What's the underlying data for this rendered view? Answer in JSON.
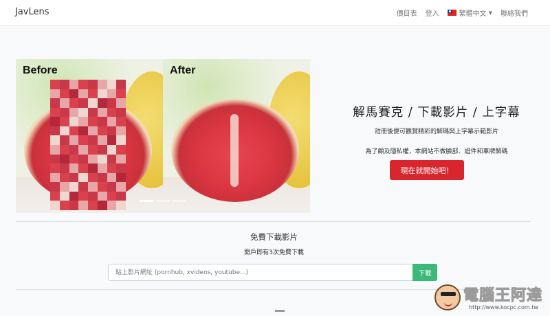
{
  "navbar": {
    "brand": "JavLens",
    "links": {
      "pricing": "價目表",
      "login": "登入",
      "language": "繁體中文",
      "contact": "聯絡我們"
    }
  },
  "hero": {
    "before_label": "Before",
    "after_label": "After",
    "title": "解馬賽克 / 下載影片 / 上字幕",
    "subtitle": "註冊後便可觀賞精彩的解碼與上字幕示範影片",
    "note": "為了顧及隱私權，本網站不做臉部、證件和車牌解碼",
    "cta_label": "現在就開始吧！",
    "cta_color": "#d9262e",
    "carousel_slides": 3,
    "carousel_active": 1
  },
  "download": {
    "title": "免費下載影片",
    "subtitle": "開戶即有3次免費下載",
    "input_placeholder": "貼上影片網址 (pornhub, xvideos, youtube...)",
    "input_value": "",
    "button_label": "下載",
    "button_color": "#3cb878"
  },
  "watermark": {
    "name": "電腦王阿達",
    "url": "http://www.kocpc.com.tw"
  }
}
